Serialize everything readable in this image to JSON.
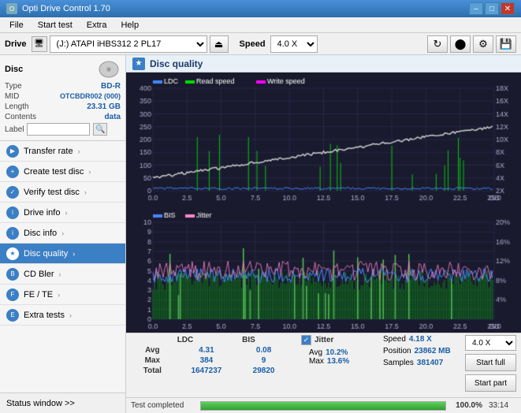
{
  "titleBar": {
    "title": "Opti Drive Control 1.70",
    "minLabel": "–",
    "maxLabel": "□",
    "closeLabel": "✕"
  },
  "menuBar": {
    "items": [
      "File",
      "Start test",
      "Extra",
      "Help"
    ]
  },
  "driveBar": {
    "label": "Drive",
    "driveValue": "(J:)  ATAPI iHBS312  2 PL17",
    "speedLabel": "Speed",
    "speedValue": "4.0 X",
    "ejectSymbol": "⏏"
  },
  "sidebar": {
    "discSection": {
      "label": "Disc",
      "typeKey": "Type",
      "typeVal": "BD-R",
      "midKey": "MID",
      "midVal": "OTCBDR002 (000)",
      "lengthKey": "Length",
      "lengthVal": "23.31 GB",
      "contentsKey": "Contents",
      "contentsVal": "data",
      "labelKey": "Label",
      "labelVal": ""
    },
    "navItems": [
      {
        "id": "transfer-rate",
        "label": "Transfer rate",
        "active": false
      },
      {
        "id": "create-test-disc",
        "label": "Create test disc",
        "active": false
      },
      {
        "id": "verify-test-disc",
        "label": "Verify test disc",
        "active": false
      },
      {
        "id": "drive-info",
        "label": "Drive info",
        "active": false
      },
      {
        "id": "disc-info",
        "label": "Disc info",
        "active": false
      },
      {
        "id": "disc-quality",
        "label": "Disc quality",
        "active": true
      },
      {
        "id": "cd-bler",
        "label": "CD Bler",
        "active": false
      },
      {
        "id": "fe-te",
        "label": "FE / TE",
        "active": false
      },
      {
        "id": "extra-tests",
        "label": "Extra tests",
        "active": false
      }
    ],
    "statusWindow": "Status window >>"
  },
  "mainPanel": {
    "title": "Disc quality",
    "chart1": {
      "legend": [
        {
          "color": "#0000ff",
          "label": "LDC"
        },
        {
          "color": "#00ff00",
          "label": "Read speed"
        },
        {
          "color": "#ff00ff",
          "label": "Write speed"
        }
      ],
      "yMax": 400,
      "yRight": [
        "18X",
        "16X",
        "14X",
        "12X",
        "10X",
        "8X",
        "6X",
        "4X",
        "2X"
      ],
      "xLabels": [
        "0.0",
        "2.5",
        "5.0",
        "7.5",
        "10.0",
        "12.5",
        "15.0",
        "17.5",
        "20.0",
        "22.5",
        "25.0 GB"
      ]
    },
    "chart2": {
      "legend": [
        {
          "color": "#0000ff",
          "label": "BIS"
        },
        {
          "color": "#ff80ff",
          "label": "Jitter"
        }
      ],
      "yMax": 10,
      "yRight": [
        "20%",
        "16%",
        "12%",
        "8%",
        "4%"
      ],
      "xLabels": [
        "0.0",
        "2.5",
        "5.0",
        "7.5",
        "10.0",
        "12.5",
        "15.0",
        "17.5",
        "20.0",
        "22.5",
        "25.0 GB"
      ]
    },
    "statsColumns": [
      "LDC",
      "BIS"
    ],
    "statsRows": [
      {
        "label": "Avg",
        "ldc": "4.31",
        "bis": "0.08"
      },
      {
        "label": "Max",
        "ldc": "384",
        "bis": "9"
      },
      {
        "label": "Total",
        "ldc": "1647237",
        "bis": "29820"
      }
    ],
    "jitter": {
      "checked": true,
      "label": "Jitter",
      "avg": "10.2%",
      "max": "13.6%",
      "maxLabel": "Max"
    },
    "speedInfo": {
      "label": "Speed",
      "val": "4.18 X",
      "selectVal": "4.0 X"
    },
    "position": {
      "label": "Position",
      "val": "23862 MB"
    },
    "samples": {
      "label": "Samples",
      "val": "381407"
    },
    "buttons": {
      "startFull": "Start full",
      "startPart": "Start part"
    },
    "progress": {
      "percent": "100.0%",
      "fill": 100,
      "time": "33:14",
      "status": "Test completed"
    }
  },
  "icons": {
    "refresh": "↻",
    "burn": "💿",
    "save": "💾",
    "settings": "⚙",
    "nav_arrow": "›",
    "checkmark": "✓"
  }
}
